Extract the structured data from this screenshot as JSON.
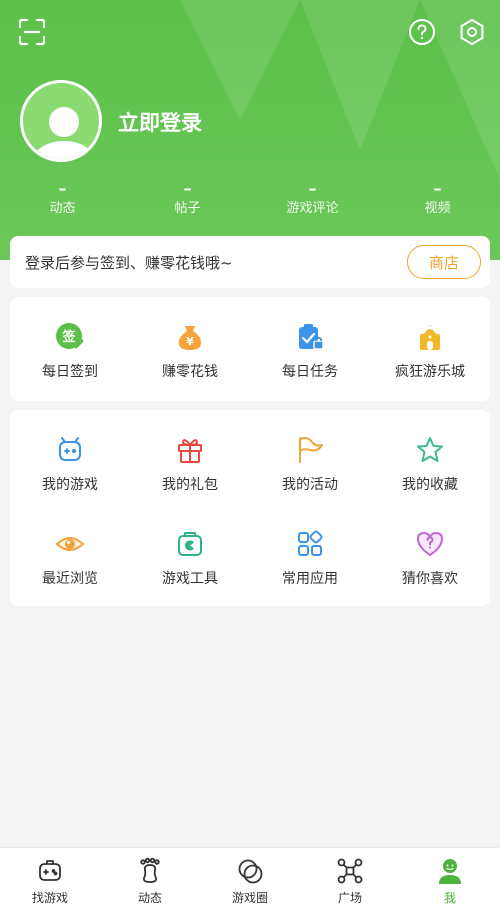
{
  "header": {
    "login_title": "立即登录",
    "stats": [
      {
        "value": "–",
        "label": "动态"
      },
      {
        "value": "–",
        "label": "帖子"
      },
      {
        "value": "–",
        "label": "游戏评论"
      },
      {
        "value": "–",
        "label": "视频"
      }
    ],
    "icons": {
      "scan": "scan-icon",
      "help": "help-icon",
      "settings": "settings-icon"
    }
  },
  "banner": {
    "text": "登录后参与签到、赚零花钱哦~",
    "shop_label": "商店"
  },
  "daily": [
    {
      "label": "每日签到",
      "icon": "sign-in-icon",
      "icon_text": "签"
    },
    {
      "label": "赚零花钱",
      "icon": "money-bag-icon",
      "icon_text": "¥"
    },
    {
      "label": "每日任务",
      "icon": "task-icon"
    },
    {
      "label": "疯狂游乐城",
      "icon": "castle-icon"
    }
  ],
  "features": [
    {
      "label": "我的游戏",
      "icon": "gamepad-icon"
    },
    {
      "label": "我的礼包",
      "icon": "gift-icon"
    },
    {
      "label": "我的活动",
      "icon": "flag-icon"
    },
    {
      "label": "我的收藏",
      "icon": "star-icon"
    },
    {
      "label": "最近浏览",
      "icon": "eye-icon"
    },
    {
      "label": "游戏工具",
      "icon": "toolbox-icon"
    },
    {
      "label": "常用应用",
      "icon": "apps-icon"
    },
    {
      "label": "猜你喜欢",
      "icon": "heart-question-icon"
    }
  ],
  "nav": [
    {
      "label": "找游戏",
      "icon": "controller-icon"
    },
    {
      "label": "动态",
      "icon": "footprint-icon"
    },
    {
      "label": "游戏圈",
      "icon": "circles-icon"
    },
    {
      "label": "广场",
      "icon": "network-icon"
    },
    {
      "label": "我",
      "icon": "profile-icon",
      "active": true
    }
  ],
  "colors": {
    "brand_green": "#5cc04a",
    "active_green": "#4cb43c",
    "shop_orange": "#f4a42b"
  }
}
